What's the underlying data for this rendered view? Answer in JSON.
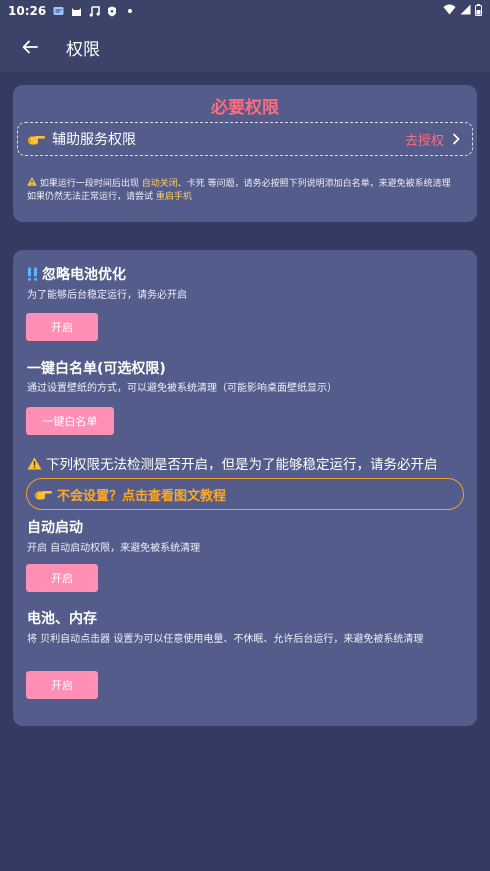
{
  "status_bar": {
    "time": "10:26",
    "icons": [
      "sms-icon",
      "cat-icon",
      "music-icon",
      "shield-icon",
      "dot-icon"
    ],
    "right_icons": [
      "wifi-icon",
      "signal-icon",
      "battery-icon"
    ]
  },
  "app_bar": {
    "title": "权限"
  },
  "required": {
    "heading": "必要权限",
    "accessibility_label": "辅助服务权限",
    "authorize_label": "去授权",
    "note_prefix": "如果运行一段时间后出现 ",
    "note_hl1": "自动关闭",
    "note_mid1": "、卡死 等问题，请务必按照下列说明添加白名单，来避免被系统清理",
    "note_line2_prefix": "如果仍然无法正常运行，请尝试 ",
    "note_hl2": "重启手机"
  },
  "optimization": {
    "battery_title": "忽略电池优化",
    "battery_desc": "为了能够后台稳定运行，请务必开启",
    "battery_btn": "开启",
    "whitelist_title": "一键白名单(可选权限)",
    "whitelist_desc": "通过设置壁纸的方式，可以避免被系统清理（可能影响桌面壁纸显示）",
    "whitelist_btn": "一键白名单",
    "warning_text": "下列权限无法检测是否开启，但是为了能够稳定运行，请务必开启",
    "tutorial_text": "不会设置？点击查看图文教程",
    "autostart_title": "自动启动",
    "autostart_desc": "开启 自动启动权限，来避免被系统清理",
    "autostart_btn": "开启",
    "battery_mem_title": "电池、内存",
    "battery_mem_desc": "将 贝利自动点击器 设置为可以任意使用电量、不休眠、允许后台运行，来避免被系统清理",
    "battery_mem_btn": "开启"
  },
  "colors": {
    "background": "#343b62",
    "card": "#535c8a",
    "accent_red": "#ff6b7f",
    "button_pink": "#ff8fb4",
    "highlight_yellow": "#ffd066",
    "tutorial_orange": "#ffa726"
  }
}
